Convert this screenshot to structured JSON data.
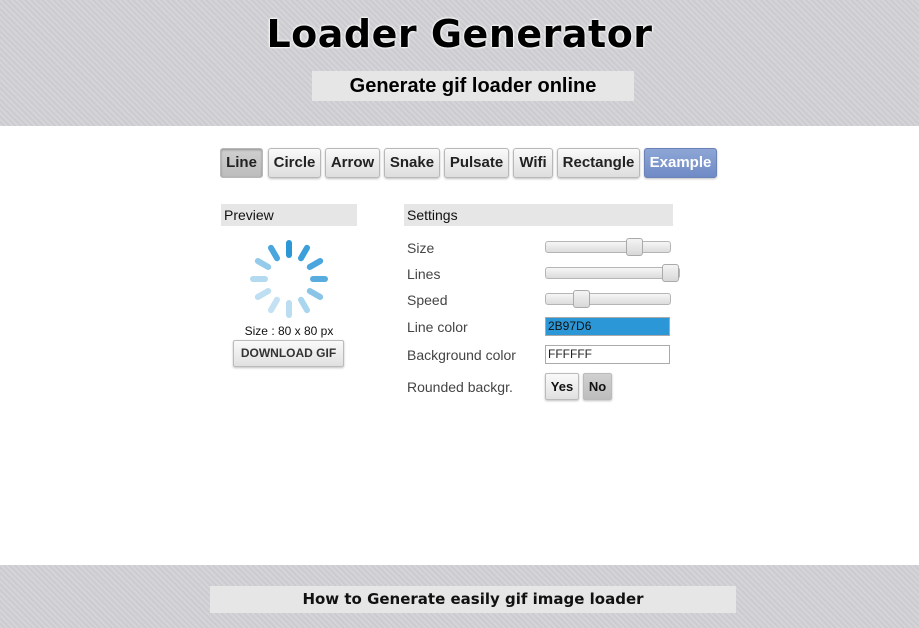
{
  "header": {
    "title": "Loader Generator",
    "subtitle": "Generate gif loader online"
  },
  "tabs": [
    {
      "label": "Line",
      "active": true
    },
    {
      "label": "Circle"
    },
    {
      "label": "Arrow"
    },
    {
      "label": "Snake"
    },
    {
      "label": "Pulsate"
    },
    {
      "label": "Wifi"
    },
    {
      "label": "Rectangle"
    },
    {
      "label": "Example"
    }
  ],
  "preview": {
    "heading": "Preview",
    "size_text": "Size : 80 x 80 px",
    "download_label": "DOWNLOAD GIF",
    "spinner_color": "#2B97D6"
  },
  "settings": {
    "heading": "Settings",
    "size_label": "Size",
    "size_value": 0.75,
    "lines_label": "Lines",
    "lines_value": 1.0,
    "speed_label": "Speed",
    "speed_value": 0.25,
    "line_color_label": "Line color",
    "line_color_value": "2B97D6",
    "bg_color_label": "Background color",
    "bg_color_value": "FFFFFF",
    "rounded_label": "Rounded backgr.",
    "yes_label": "Yes",
    "no_label": "No"
  },
  "footer": {
    "link_text": "How to Generate easily gif image loader"
  }
}
